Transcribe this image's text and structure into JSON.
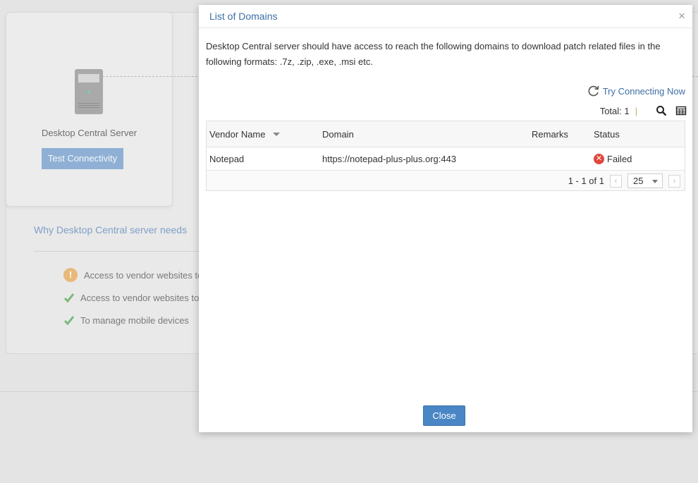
{
  "background": {
    "server_label": "Desktop Central Server",
    "test_button": "Test Connectivity",
    "why_title": "Why Desktop Central server needs",
    "why_items": [
      {
        "icon": "warning-icon",
        "text": "Access to vendor websites to"
      },
      {
        "icon": "check-icon",
        "text": "Access to vendor websites to t"
      },
      {
        "icon": "check-icon",
        "text": "To manage mobile devices"
      }
    ]
  },
  "modal": {
    "title": "List of Domains",
    "close_glyph": "×",
    "description": "Desktop Central server should have access to reach the following domains to download patch related files in the following formats: .7z, .zip, .exe, .msi etc.",
    "try_connecting": "Try Connecting Now",
    "total_label": "Total: 1",
    "total_sep": "|",
    "columns": {
      "vendor": "Vendor Name",
      "domain": "Domain",
      "remarks": "Remarks",
      "status": "Status"
    },
    "rows": [
      {
        "vendor": "Notepad",
        "domain": "https://notepad-plus-plus.org:443",
        "remarks": "",
        "status": "Failed"
      }
    ],
    "pager": {
      "range": "1 - 1 of 1",
      "page_size": "25",
      "prev": "‹",
      "next": "›"
    },
    "close_button": "Close"
  },
  "colors": {
    "accent": "#4a86c5",
    "title_blue": "#3d6ea5",
    "failed_red": "#e0463b",
    "warn_orange": "#e8b97a",
    "check_green": "#7ab87a"
  }
}
